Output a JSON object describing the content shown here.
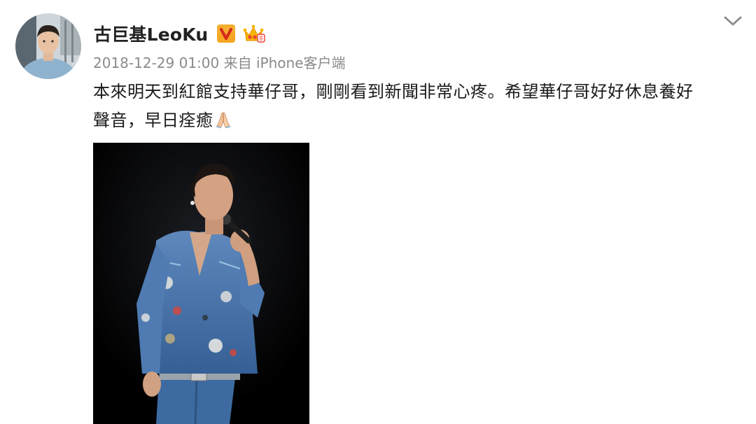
{
  "post": {
    "author": {
      "name": "古巨基LeoKu",
      "avatar": "avatar",
      "badges": [
        "verified-v-icon",
        "crown-member-icon"
      ]
    },
    "timestamp": "2018-12-29 01:00",
    "source": "来自 iPhone客户端",
    "text_line1": "本來明天到紅館支持華仔哥，剛剛看到新聞非常心疼。希望華仔哥好好休息養好",
    "text_line2": "聲音，早日痊癒",
    "emoji": "pray-hands-icon",
    "menu_icon": "chevron-down-icon",
    "image": "concert-photo"
  },
  "colors": {
    "text": "#1a1a1a",
    "meta": "#8a8a8a",
    "verified_badge": "#f5a623",
    "crown": "#f7b500"
  }
}
